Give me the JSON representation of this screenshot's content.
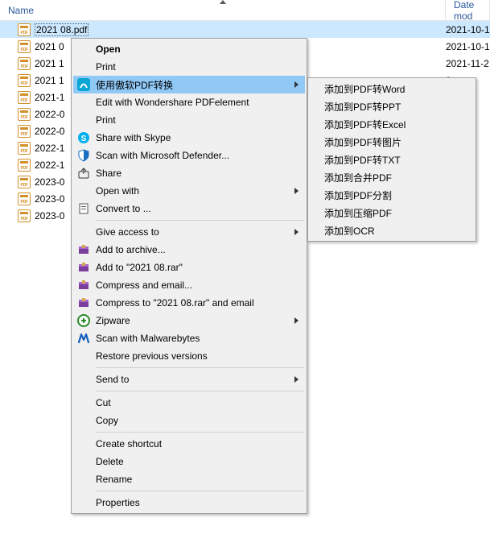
{
  "header": {
    "name_label": "Name",
    "date_label": "Date mod"
  },
  "files": [
    {
      "name": "2021 08.pdf",
      "date": "2021-10-1",
      "selected": true
    },
    {
      "name": "2021 0",
      "date": "2021-10-1"
    },
    {
      "name": "2021 1",
      "date": "2021-11-2"
    },
    {
      "name": "2021 1",
      "date": "0"
    },
    {
      "name": "2021-1",
      "date": "3-0"
    },
    {
      "name": "2022-0",
      "date": "3-0"
    },
    {
      "name": "2022-0",
      "date": "3-0"
    },
    {
      "name": "2022-1",
      "date": "3-0"
    },
    {
      "name": "2022-1",
      "date": "3-0"
    },
    {
      "name": "2023-0",
      "date": "3-0"
    },
    {
      "name": "2023-0",
      "date": "3-0"
    },
    {
      "name": "2023-0",
      "date": "4-0"
    }
  ],
  "ctx": {
    "open": "Open",
    "print": "Print",
    "pdfconv": "使用傲软PDF转换",
    "wondershare": "Edit with Wondershare PDFelement",
    "print2": "Print",
    "skype": "Share with Skype",
    "defender": "Scan with Microsoft Defender...",
    "share": "Share",
    "openwith": "Open with",
    "convertto": "Convert to ...",
    "giveaccess": "Give access to",
    "addarchive": "Add to archive...",
    "addrar": "Add to \"2021 08.rar\"",
    "compemail": "Compress and email...",
    "compraremail": "Compress to \"2021 08.rar\" and email",
    "zipware": "Zipware",
    "malwarebytes": "Scan with Malwarebytes",
    "restore": "Restore previous versions",
    "sendto": "Send to",
    "cut": "Cut",
    "copy": "Copy",
    "shortcut": "Create shortcut",
    "delete": "Delete",
    "rename": "Rename",
    "properties": "Properties"
  },
  "sub": {
    "word": "添加到PDF转Word",
    "ppt": "添加到PDF转PPT",
    "excel": "添加到PDF转Excel",
    "img": "添加到PDF转图片",
    "txt": "添加到PDF转TXT",
    "merge": "添加到合并PDF",
    "split": "添加到PDF分割",
    "compress": "添加到压缩PDF",
    "ocr": "添加到OCR"
  }
}
